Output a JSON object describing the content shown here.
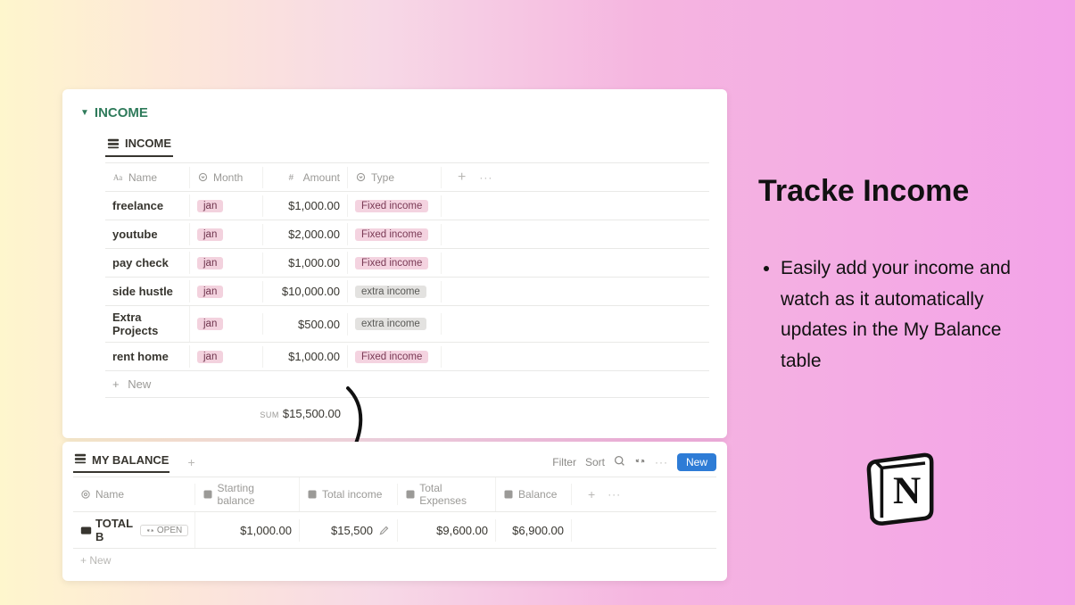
{
  "side": {
    "title": "Tracke Income",
    "bullet": "Easily add your income and watch as it automatically updates in the My Balance table"
  },
  "income": {
    "toggle_label": "INCOME",
    "view_name": "INCOME",
    "columns": {
      "name": "Name",
      "month": "Month",
      "amount": "Amount",
      "type": "Type"
    },
    "rows": [
      {
        "name": "freelance",
        "month": "jan",
        "amount": "$1,000.00",
        "type": "Fixed income",
        "type_variant": "pink"
      },
      {
        "name": "youtube",
        "month": "jan",
        "amount": "$2,000.00",
        "type": "Fixed income",
        "type_variant": "pink"
      },
      {
        "name": "pay check",
        "month": "jan",
        "amount": "$1,000.00",
        "type": "Fixed income",
        "type_variant": "pink"
      },
      {
        "name": "side hustle",
        "month": "jan",
        "amount": "$10,000.00",
        "type": "extra income",
        "type_variant": "gray"
      },
      {
        "name": "Extra Projects",
        "month": "jan",
        "amount": "$500.00",
        "type": "extra income",
        "type_variant": "gray"
      },
      {
        "name": "rent home",
        "month": "jan",
        "amount": "$1,000.00",
        "type": "Fixed income",
        "type_variant": "pink"
      }
    ],
    "new_label": "New",
    "sum_label": "SUM",
    "sum_value": "$15,500.00"
  },
  "balance": {
    "view_name": "MY BALANCE",
    "actions": {
      "filter": "Filter",
      "sort": "Sort",
      "new": "New"
    },
    "columns": {
      "name": "Name",
      "start": "Starting balance",
      "inc": "Total income",
      "exp": "Total Expenses",
      "bal": "Balance"
    },
    "row": {
      "name": "TOTAL B",
      "open": "OPEN",
      "start": "$1,000.00",
      "inc": "$15,500",
      "exp": "$9,600.00",
      "bal": "$6,900.00"
    },
    "new_label": "New"
  }
}
